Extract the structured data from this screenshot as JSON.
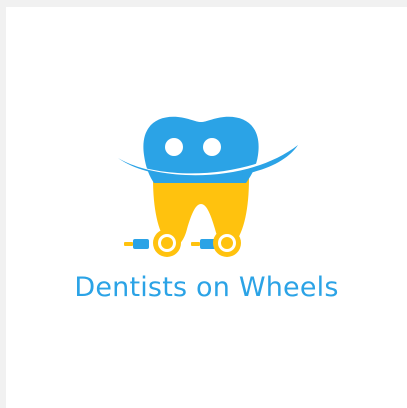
{
  "brand": {
    "name": "Dentists on Wheels"
  },
  "colors": {
    "page_background": "#f1f1f1",
    "card_background": "#ffffff",
    "tooth_blue": "#2ba3e6",
    "tooth_yellow": "#ffc20e",
    "text_blue": "#2ba3e6",
    "eye_white": "#ffffff"
  },
  "icons": {
    "logo": "smiling-tooth-on-wheels-icon"
  }
}
